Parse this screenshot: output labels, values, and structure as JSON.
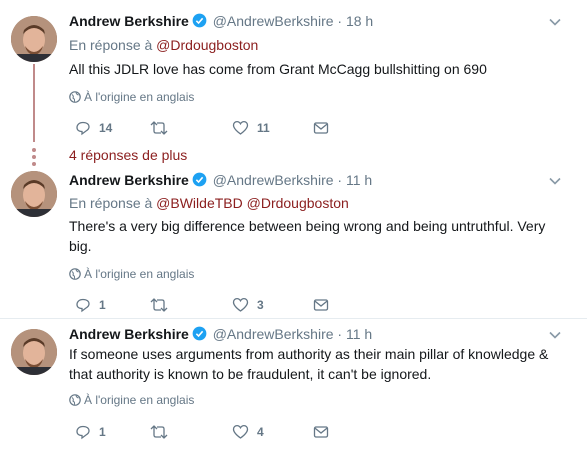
{
  "tweets": [
    {
      "name": "Andrew Berkshire",
      "handle": "@AndrewBerkshire",
      "time": "· 18 h",
      "reply_prefix": "En réponse à ",
      "reply_mentions": "@Drdougboston",
      "text": "All this JDLR love has come from Grant McCagg bullshitting on 690",
      "translate": "À l'origine en anglais",
      "replies": "14",
      "retweets": "",
      "likes": "11"
    },
    {
      "name": "Andrew Berkshire",
      "handle": "@AndrewBerkshire",
      "time": "· 11 h",
      "reply_prefix": "En réponse à ",
      "reply_mentions": "@BWildeTBD @Drdougboston",
      "text": "There's a very big difference between being wrong and being untruthful. Very big.",
      "translate": "À l'origine en anglais",
      "replies": "1",
      "retweets": "",
      "likes": "3"
    },
    {
      "name": "Andrew Berkshire",
      "handle": "@AndrewBerkshire",
      "time": "· 11 h",
      "text": "If someone uses arguments from authority as their main pillar of knowledge & that authority is known to be fraudulent, it can't be ignored.",
      "translate": "À l'origine en anglais",
      "replies": "1",
      "retweets": "",
      "likes": "4"
    }
  ],
  "more_replies": "4 réponses de plus",
  "colors": {
    "mention": "#8b1e1e",
    "thread": "#c08a8a",
    "verified": "#1da1f2",
    "muted": "#657786"
  },
  "icons": [
    "verified-badge-icon",
    "chevron-down-icon",
    "globe-icon",
    "reply-icon",
    "retweet-icon",
    "like-icon",
    "direct-message-icon"
  ]
}
